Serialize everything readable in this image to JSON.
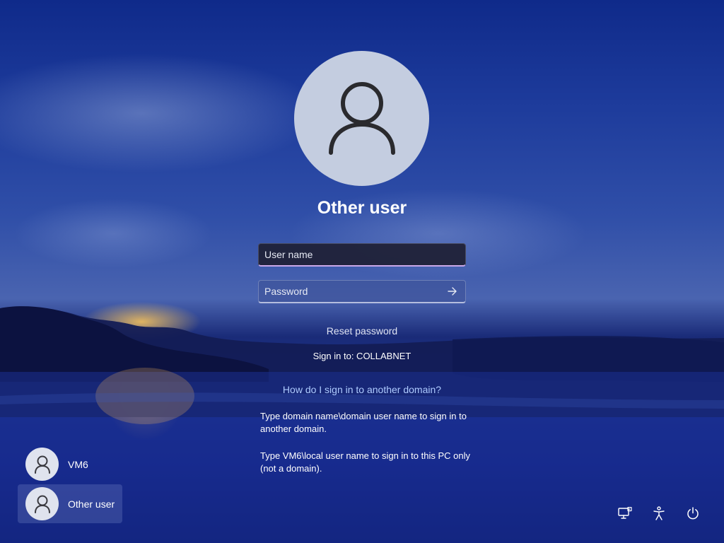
{
  "selected_user": {
    "name": "Other user"
  },
  "form": {
    "username_placeholder": "User name",
    "password_placeholder": "Password"
  },
  "links": {
    "reset_password": "Reset password",
    "domain_help": "How do I sign in to another domain?"
  },
  "sign_in_to": "Sign in to: COLLABNET",
  "help": {
    "paragraph_1": "Type domain name\\domain user name to sign in to another domain.",
    "paragraph_2": "Type VM6\\local user name to sign in to this PC only (not a domain)."
  },
  "user_list": [
    {
      "label": "VM6",
      "selected": false
    },
    {
      "label": "Other user",
      "selected": true
    }
  ],
  "system_icons": [
    "network-icon",
    "accessibility-icon",
    "power-icon"
  ],
  "colors": {
    "focus_underline": "#c9a8e8",
    "link": "#aecbff",
    "avatar_bg": "#c4cde0"
  }
}
